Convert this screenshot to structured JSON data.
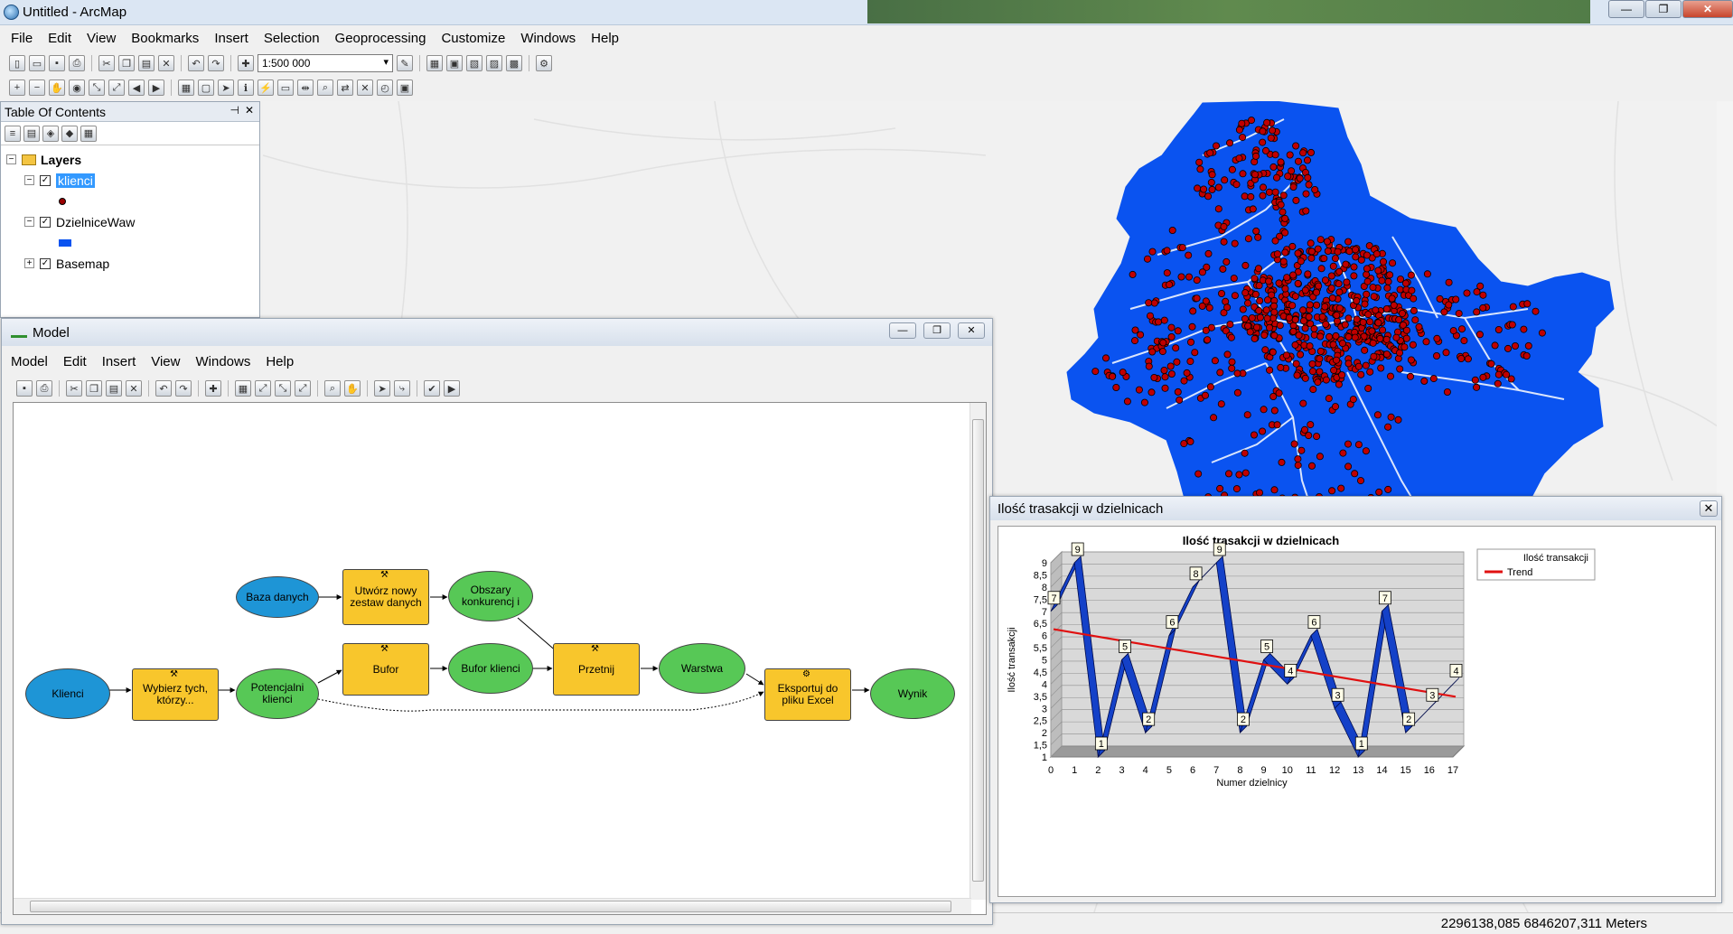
{
  "app": {
    "title": "Untitled - ArcMap"
  },
  "menu": [
    "File",
    "Edit",
    "View",
    "Bookmarks",
    "Insert",
    "Selection",
    "Geoprocessing",
    "Customize",
    "Windows",
    "Help"
  ],
  "toolbar": {
    "scale": "1:500 000"
  },
  "toc": {
    "title": "Table Of Contents",
    "root": "Layers",
    "layers": [
      {
        "name": "klienci",
        "symbol": "#9b0000"
      },
      {
        "name": "DzielniceWaw",
        "symbol": "#0a53f0"
      },
      {
        "name": "Basemap"
      }
    ]
  },
  "status": {
    "coords": "2296138,085  6846207,311 Meters"
  },
  "model": {
    "title": "Model",
    "menu": [
      "Model",
      "Edit",
      "Insert",
      "View",
      "Windows",
      "Help"
    ],
    "nodes": [
      {
        "id": "baza",
        "label": "Baza danych"
      },
      {
        "id": "utworz",
        "label": "Utwórz nowy zestaw danych"
      },
      {
        "id": "obszary",
        "label": "Obszary konkurencj i"
      },
      {
        "id": "klienci",
        "label": "Klienci"
      },
      {
        "id": "wybierz",
        "label": "Wybierz tych, którzy..."
      },
      {
        "id": "potencjalni",
        "label": "Potencjalni klienci"
      },
      {
        "id": "bufor",
        "label": "Bufor"
      },
      {
        "id": "bufor_klienci",
        "label": "Bufor klienci"
      },
      {
        "id": "przetnij",
        "label": "Przetnij"
      },
      {
        "id": "warstwa",
        "label": "Warstwa"
      },
      {
        "id": "eksportuj",
        "label": "Eksportuj do pliku Excel"
      },
      {
        "id": "wynik",
        "label": "Wynik"
      }
    ]
  },
  "chartwin": {
    "title": "Ilość trasakcji w dzielnicach"
  },
  "chart_data": {
    "type": "line",
    "title": "Ilość trasakcji w dzielnicach",
    "xlabel": "Numer dzielnicy",
    "ylabel": "Ilość transakcji",
    "x": [
      0,
      1,
      2,
      3,
      4,
      5,
      6,
      7,
      8,
      9,
      10,
      11,
      12,
      13,
      14,
      15,
      16,
      17
    ],
    "xlim": [
      0,
      17
    ],
    "ylim": [
      1,
      9
    ],
    "yticks": [
      1,
      1.5,
      2,
      2.5,
      3,
      3.5,
      4,
      4.5,
      5,
      5.5,
      6,
      6.5,
      7,
      7.5,
      8,
      8.5,
      9
    ],
    "series": [
      {
        "name": "Ilość transakcji",
        "color": "#1441c8",
        "x": [
          0,
          1,
          2,
          3,
          4,
          5,
          6,
          7,
          8,
          9,
          10,
          11,
          12,
          13,
          14,
          15,
          16,
          17
        ],
        "values": [
          7,
          9,
          1,
          5,
          2,
          6,
          8,
          9,
          2,
          5,
          4,
          6,
          3,
          1,
          7,
          2,
          3,
          4
        ]
      },
      {
        "name": "Trend",
        "color": "#e01010",
        "x": [
          0,
          17
        ],
        "values": [
          6.15,
          3.37
        ]
      }
    ],
    "legend": "top-right",
    "grid": true
  }
}
